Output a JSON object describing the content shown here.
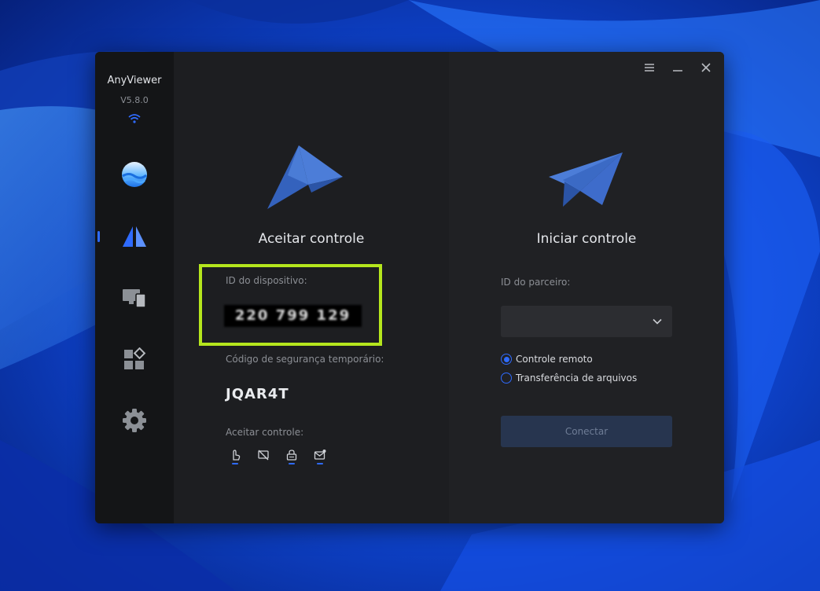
{
  "app": {
    "name": "AnyViewer",
    "version": "V5.8.0"
  },
  "colors": {
    "accent": "#2f6bff",
    "highlight_border": "#b5e61d",
    "window_bg": "#1b1c1f",
    "sidebar_bg": "#141517"
  },
  "sidebar": {
    "items": [
      {
        "icon": "planet-icon"
      },
      {
        "icon": "remote-control-icon",
        "active": true
      },
      {
        "icon": "devices-icon"
      },
      {
        "icon": "apps-grid-icon"
      },
      {
        "icon": "settings-gear-icon"
      }
    ]
  },
  "window_controls": [
    "menu-icon",
    "minimize-icon",
    "close-icon"
  ],
  "accept": {
    "title": "Aceitar controle",
    "device_id_label": "ID do dispositivo:",
    "device_id_value": "220 799 129",
    "security_code_label": "Código de segurança temporário:",
    "security_code_value": "JQAR4T",
    "accept_control_label": "Aceitar controle:",
    "permissions": [
      "mouse-icon",
      "screen-off-icon",
      "lock-icon",
      "mail-check-icon"
    ]
  },
  "start": {
    "title": "Iniciar controle",
    "partner_id_label": "ID do parceiro:",
    "partner_id_value": "",
    "options": [
      {
        "label": "Controle remoto",
        "selected": true
      },
      {
        "label": "Transferência de arquivos",
        "selected": false
      }
    ],
    "connect_label": "Conectar"
  }
}
